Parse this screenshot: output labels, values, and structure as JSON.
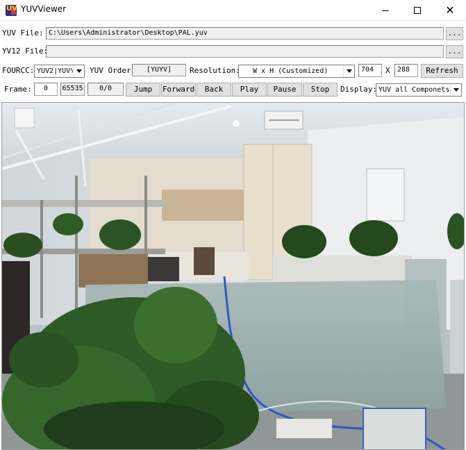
{
  "window": {
    "title": "YUVViewer",
    "logo_text": "UV"
  },
  "yuv_file": {
    "label": "YUV File:",
    "path": "C:\\Users\\Administrator\\Desktop\\PAL.yuv",
    "browse_label": "..."
  },
  "yv12_file": {
    "label": "YV12 File:",
    "path": "",
    "browse_label": "..."
  },
  "format_row": {
    "fourcc_label": "FOURCC:",
    "fourcc_value": "YUV2|YUV\\",
    "yuv_order_label": "YUV Order:",
    "yuv_order_value": "[YUYV]",
    "resolution_label": "Resolution:",
    "resolution_value": "W x H (Customized)",
    "width": "704",
    "x_label": "X",
    "height": "288",
    "refresh_label": "Refresh"
  },
  "frame_row": {
    "frame_label": "Frame:",
    "frame_value": "0",
    "frame_max": "65535",
    "frame_count": "0/0",
    "jump_label": "Jump",
    "forward_label": "Forward",
    "back_label": "Back",
    "play_label": "Play",
    "pause_label": "Pause",
    "stop_label": "Stop",
    "display_label": "Display:",
    "display_value": "YUV all Componets"
  },
  "colors": {
    "button_face": "#e1e1e1",
    "field_face": "#f0f0f0",
    "border": "#adadad"
  }
}
